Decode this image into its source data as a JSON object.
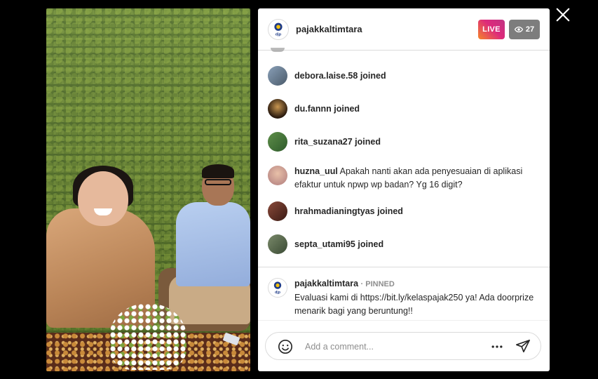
{
  "header": {
    "username": "pajakkaltimtara",
    "live_label": "LIVE",
    "viewer_count": "27",
    "avatar_text": "djp"
  },
  "comments": [
    {
      "username": "debora.laise.58",
      "action": "joined",
      "message": ""
    },
    {
      "username": "du.fannn",
      "action": "joined",
      "message": ""
    },
    {
      "username": "rita_suzana27",
      "action": "joined",
      "message": ""
    },
    {
      "username": "huzna_uul",
      "action": "",
      "message": "Apakah nanti akan ada penyesuaian di aplikasi efaktur untuk npwp wp badan? Yg 16 digit?"
    },
    {
      "username": "hrahmadianingtyas",
      "action": "joined",
      "message": ""
    },
    {
      "username": "septa_utami95",
      "action": "joined",
      "message": ""
    }
  ],
  "pinned": {
    "username": "pajakkaltimtara",
    "tag": "· PINNED",
    "message": "Evaluasi kami di https://bit.ly/kelaspajak250 ya! Ada doorprize menarik bagi yang beruntung!!"
  },
  "composer": {
    "placeholder": "Add a comment..."
  },
  "colors": {
    "live_gradient_start": "#f58529",
    "live_gradient_end": "#c13584",
    "viewer_badge": "#7d7d7d",
    "text_primary": "#262626",
    "text_secondary": "#8e8e8e"
  },
  "icons": {
    "close": "close-icon",
    "eye": "eye-icon",
    "emoji": "emoji-icon",
    "more": "more-icon",
    "send": "send-icon"
  }
}
